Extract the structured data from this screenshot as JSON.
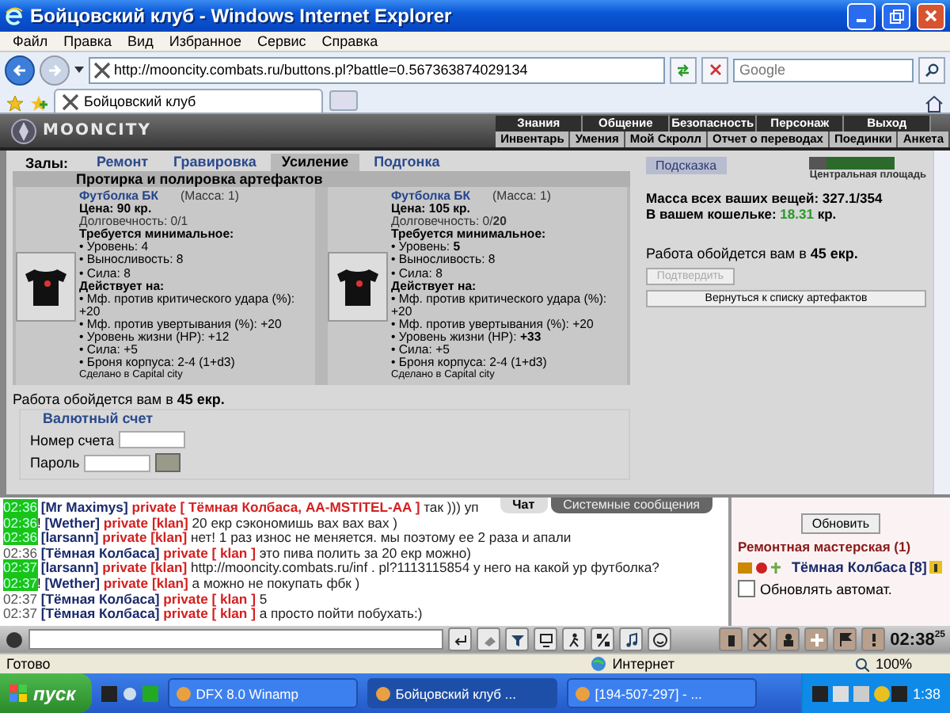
{
  "window": {
    "title": "Бойцовский клуб - Windows Internet Explorer"
  },
  "menu": [
    "Файл",
    "Правка",
    "Вид",
    "Избранное",
    "Сервис",
    "Справка"
  ],
  "address_bar": {
    "url": "http://mooncity.combats.ru/buttons.pl?battle=0.567363874029134",
    "search_placeholder": "Google"
  },
  "browser_tab": {
    "label": "Бойцовский клуб"
  },
  "game_header": {
    "logo": "MOONCITY",
    "nav_top": [
      "Знания",
      "Общение",
      "Безопасность",
      "Персонаж",
      "Выход"
    ],
    "nav_bottom": [
      "Инвентарь",
      "Умения",
      "Мой Скролл",
      "Отчет о переводах",
      "Поединки",
      "Анкета"
    ]
  },
  "halls": {
    "label": "Залы:",
    "tabs": [
      {
        "label": "Ремонт",
        "selected": false
      },
      {
        "label": "Гравировка",
        "selected": false
      },
      {
        "label": "Усиление",
        "selected": true
      },
      {
        "label": "Подгонка",
        "selected": false
      }
    ]
  },
  "section_title": "Протирка и полировка артефактов",
  "items": [
    {
      "name": "Футболка БК",
      "mass": "(Масса: 1)",
      "price": "Цена: 90 кр.",
      "durability": "Долговечность: 0/1",
      "requirements_title": "Требуется минимальное:",
      "requirements": [
        "• Уровень: 4",
        "• Выносливость: 8",
        "• Сила: 8"
      ],
      "effects_title": "Действует на:",
      "effects": [
        "• Мф. против критического удара (%): +20",
        "• Мф. против увертывания (%): +20",
        "• Уровень жизни (HP): +12",
        "• Сила: +5",
        "• Броня корпуса: 2-4 (1+d3)"
      ],
      "maker": "Сделано в Capital city"
    },
    {
      "name": "Футболка БК",
      "mass": "(Масса: 1)",
      "price": "Цена: 105 кр.",
      "durability": "Долговечность: 0/**20**",
      "requirements_title": "Требуется минимальное:",
      "requirements": [
        "• Уровень: **5**",
        "• Выносливость: 8",
        "• Сила: 8"
      ],
      "effects_title": "Действует на:",
      "effects": [
        "• Мф. против критического удара (%): +20",
        "• Мф. против увертывания (%): +20",
        "• Уровень жизни (HP): **+33**",
        "• Сила: +5",
        "• Броня корпуса: 2-4 (1+d3)"
      ],
      "maker": "Сделано в Capital city"
    }
  ],
  "cost_note": "Работа обойдется вам в **45 екр.**",
  "currency_account": {
    "title": "Валютный счет",
    "account_label": "Номер счета",
    "password_label": "Пароль"
  },
  "side_info": {
    "hint_button": "Подсказка",
    "location": "Центральная площадь",
    "mass": "Масса всех ваших вещей: 327.1/354",
    "wallet_label": "В вашем кошельке:",
    "wallet_amount": "18.31",
    "wallet_unit": "кр.",
    "cost_note": "Работа обойдется вам в **45 екр.**",
    "confirm_button": {
      "label": "Подтвердить",
      "disabled": true
    },
    "back_button": "Вернуться к списку артефактов"
  },
  "chat_tabs": [
    {
      "label": "Чат",
      "selected": true
    },
    {
      "label": "Системные сообщения",
      "selected": false
    }
  ],
  "chat_messages": [
    {
      "time": "02:36",
      "highlighted": true,
      "sender": "[Mr Maximys]",
      "recipients": "private [ Тёмная Колбаса, AA-MSTITEL-AA ]",
      "text": "так ))) уп"
    },
    {
      "time": "02:36",
      "highlighted": true,
      "mark": "!",
      "sender": "[Wether]",
      "recipients": "private [klan]",
      "text": "20 екр сэкономишь вах вах вах )"
    },
    {
      "time": "02:36",
      "highlighted": true,
      "sender": "[larsann]",
      "recipients": "private [klan]",
      "text": "нет! 1 раз износ не меняется. мы поэтому ее 2 раза и апали"
    },
    {
      "time": "02:36",
      "highlighted": false,
      "sender": "[Тёмная Колбаса]",
      "recipients": "private [ klan ]",
      "text": "это пива полить за 20 екр можно)"
    },
    {
      "time": "02:37",
      "highlighted": true,
      "sender": "[larsann]",
      "recipients": "private [klan]",
      "text": "http://mooncity.combats.ru/inf . pl?1113115854 у него на какой ур футболка?"
    },
    {
      "time": "02:37",
      "highlighted": true,
      "mark": "!",
      "sender": "[Wether]",
      "recipients": "private [klan]",
      "text": "а можно не покупать фбк )"
    },
    {
      "time": "02:37",
      "highlighted": false,
      "sender": "[Тёмная Колбаса]",
      "recipients": "private [ klan ]",
      "text": "5"
    },
    {
      "time": "02:37",
      "highlighted": false,
      "sender": "[Тёмная Колбаса]",
      "recipients": "private [ klan ]",
      "text": "а просто пойти побухать:)"
    }
  ],
  "room_panel": {
    "refresh_button": "Обновить",
    "title": "Ремонтная мастерская (1)",
    "users": [
      {
        "name": "Тёмная Колбаса",
        "level": "[8]"
      }
    ],
    "auto_refresh": {
      "label": "Обновлять автомат.",
      "checked": false
    }
  },
  "game_clock": {
    "time": "02:38",
    "seconds": "25"
  },
  "status_bar": {
    "text": "Готово",
    "zone": "Интернет",
    "zoom": "100%"
  },
  "taskbar": {
    "start": "пуск",
    "tasks": [
      {
        "label": "DFX 8.0 Winamp",
        "selected": false
      },
      {
        "label": "Бойцовский клуб ...",
        "selected": true
      },
      {
        "label": "[194-507-297] - ...",
        "selected": false
      }
    ],
    "clock": "1:38"
  }
}
